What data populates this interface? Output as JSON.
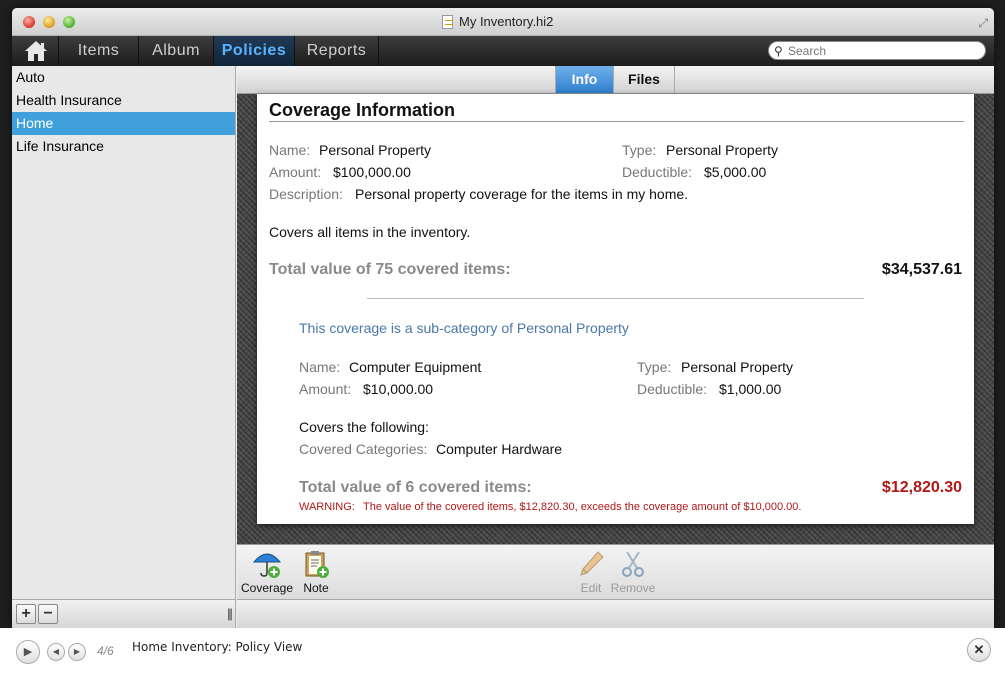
{
  "window": {
    "title": "My Inventory.hi2"
  },
  "nav": {
    "tabs": [
      {
        "label": "Items",
        "active": false
      },
      {
        "label": "Album",
        "active": false
      },
      {
        "label": "Policies",
        "active": true
      },
      {
        "label": "Reports",
        "active": false
      }
    ],
    "search_placeholder": "Search"
  },
  "sidebar": {
    "items": [
      {
        "label": "Auto",
        "selected": false
      },
      {
        "label": "Health Insurance",
        "selected": false
      },
      {
        "label": "Home",
        "selected": true
      },
      {
        "label": "Life Insurance",
        "selected": false
      }
    ],
    "add_label": "+",
    "remove_label": "−"
  },
  "segments": [
    {
      "label": "Info",
      "active": true
    },
    {
      "label": "Files",
      "active": false
    }
  ],
  "coverage": {
    "title": "Coverage Information",
    "name_label": "Name:",
    "name": "Personal Property",
    "type_label": "Type:",
    "type": "Personal Property",
    "amount_label": "Amount:",
    "amount": "$100,000.00",
    "deductible_label": "Deductible:",
    "deductible": "$5,000.00",
    "description_label": "Description:",
    "description": "Personal property coverage for the items in my home.",
    "covers_text": "Covers all items in the inventory.",
    "total_label": "Total value of 75 covered items:",
    "total_value": "$34,537.61"
  },
  "subcoverage": {
    "heading": "This coverage is a sub-category of Personal Property",
    "name_label": "Name:",
    "name": "Computer Equipment",
    "type_label": "Type:",
    "type": "Personal Property",
    "amount_label": "Amount:",
    "amount": "$10,000.00",
    "deductible_label": "Deductible:",
    "deductible": "$1,000.00",
    "covers_text": "Covers the following:",
    "categories_label": "Covered Categories:",
    "categories": "Computer Hardware",
    "total_label": "Total value of 6 covered items:",
    "total_value": "$12,820.30",
    "warning_label": "WARNING:",
    "warning_text": "The value of the covered items, $12,820.30, exceeds the coverage amount of $10,000.00."
  },
  "actions": {
    "coverage": "Coverage",
    "note": "Note",
    "edit": "Edit",
    "remove": "Remove"
  },
  "playback": {
    "page": "4/6",
    "caption": "Home Inventory: Policy View"
  },
  "colors": {
    "accent": "#3fa0db",
    "active_tab_text": "#5ab3ff",
    "warning": "#b01818",
    "subcategory_link": "#4a78a8"
  }
}
